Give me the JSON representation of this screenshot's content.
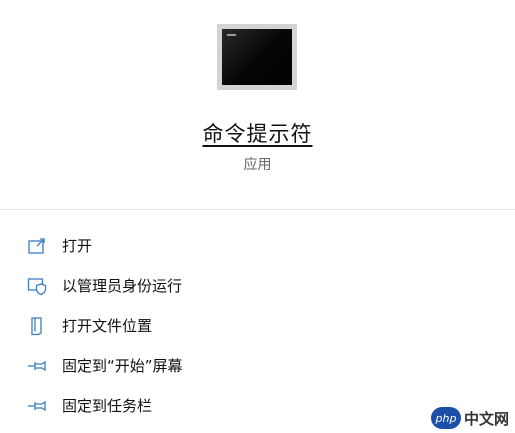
{
  "app": {
    "title": "命令提示符",
    "subtitle": "应用"
  },
  "actions": [
    {
      "label": "打开",
      "icon": "open-window-icon"
    },
    {
      "label": "以管理员身份运行",
      "icon": "admin-shield-icon"
    },
    {
      "label": "打开文件位置",
      "icon": "folder-location-icon"
    },
    {
      "label": "固定到“开始”屏幕",
      "icon": "pin-icon"
    },
    {
      "label": "固定到任务栏",
      "icon": "pin-icon"
    }
  ],
  "watermark": {
    "badge": "php",
    "text": "中文网"
  },
  "colors": {
    "icon_blue": "#3a7ebf",
    "divider": "#e6e6e6"
  }
}
